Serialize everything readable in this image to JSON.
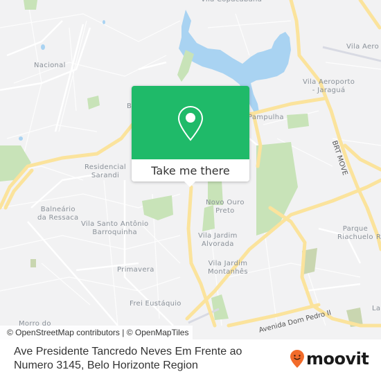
{
  "map": {
    "colors": {
      "background": "#f2f2f3",
      "water": "#a9d3f2",
      "park": "#c8e3b8",
      "major_road": "#fbe39c",
      "minor_road": "#ffffff",
      "accent": "#1fba69"
    },
    "labels": [
      {
        "id": "vila-copacabana",
        "text": "Vila Copacabana"
      },
      {
        "id": "nacional",
        "text": "Nacional"
      },
      {
        "id": "vila-aero",
        "text": "Vila Aero"
      },
      {
        "id": "vila-aeroporto-jaragua",
        "text": "Vila Aeroporto\n- Jaraguá"
      },
      {
        "id": "pampulha",
        "text": "Pampulha"
      },
      {
        "id": "b-partial",
        "text": "B"
      },
      {
        "id": "residencial-sarandi",
        "text": "Residencial\nSarandi"
      },
      {
        "id": "balneario-da-ressaca",
        "text": "Balneário\nda Ressaca"
      },
      {
        "id": "vila-santo-antonio-barroquinha",
        "text": "Vila Santo Antônio\nBarroquinha"
      },
      {
        "id": "novo-ouro-preto",
        "text": "Novo Ouro\nPreto"
      },
      {
        "id": "vila-jardim-alvorada",
        "text": "Vila Jardim\nAlvorada"
      },
      {
        "id": "vila-jardim-montanhes",
        "text": "Vila Jardim\nMontanhês"
      },
      {
        "id": "primavera",
        "text": "Primavera"
      },
      {
        "id": "frei-eustaquio",
        "text": "Frei Eustáquio"
      },
      {
        "id": "parque-riachuelo",
        "text": "Parque\nRiachuelo"
      },
      {
        "id": "r-partial",
        "text": "R"
      },
      {
        "id": "la-partial",
        "text": "La"
      },
      {
        "id": "morro-do",
        "text": "Morro do"
      }
    ],
    "road_labels": [
      {
        "id": "brt-move",
        "text": "BRT MOVE"
      },
      {
        "id": "avenida-dom-pedro-ii",
        "text": "Avenida Dom Pedro II"
      }
    ]
  },
  "popup": {
    "icon": "map-pin-icon",
    "button_label": "Take me there"
  },
  "attribution": "© OpenStreetMap contributors | © OpenMapTiles",
  "footer": {
    "title": "Ave Presidente Tancredo Neves Em Frente ao Numero 3145, Belo Horizonte Region",
    "logo_text": "moovit",
    "logo_icon": "moovit-pin-icon",
    "logo_color": "#f26b2a"
  }
}
